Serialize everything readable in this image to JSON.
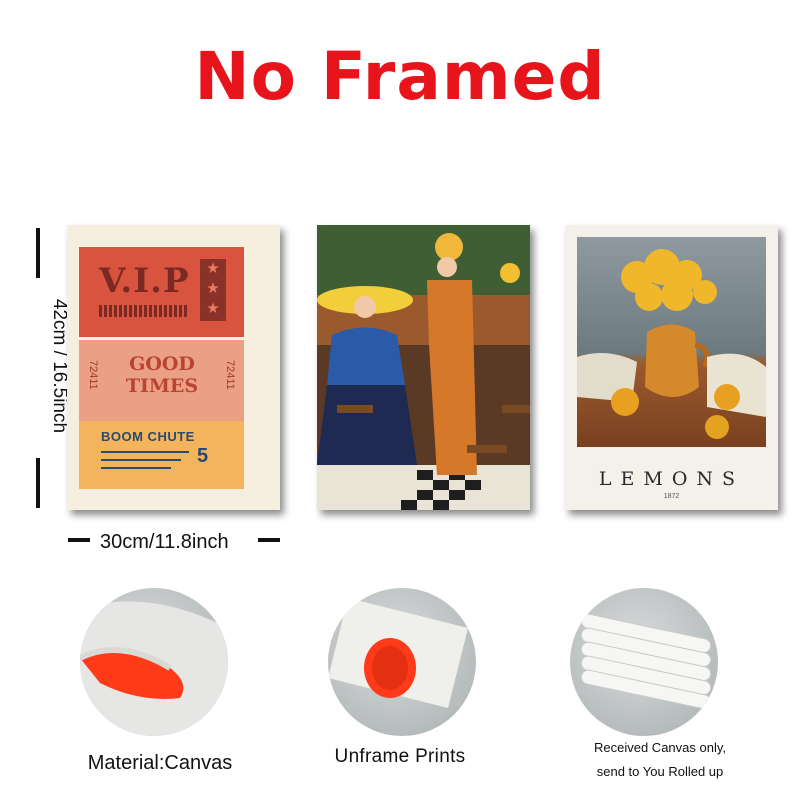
{
  "headline": "No Framed",
  "dimensions": {
    "height_label": "42cm / 16.5inch",
    "width_label": "30cm/11.8inch"
  },
  "posters": {
    "tickets": {
      "vip": "V.I.P",
      "good_times_line1": "GOOD",
      "good_times_line2": "TIMES",
      "ticket_number": "72411",
      "boom_chute": "BOOM CHUTE",
      "day": "5"
    },
    "lemons": {
      "title": "LEMONS",
      "year": "1872"
    }
  },
  "captions": {
    "material": "Material:Canvas",
    "unframe": "Unframe  Prints",
    "received_line1": "Received Canvas only,",
    "received_line2": "send to You Rolled up"
  },
  "colors": {
    "headline": "#e8141c",
    "canvas_back": "#ff3b1a"
  }
}
